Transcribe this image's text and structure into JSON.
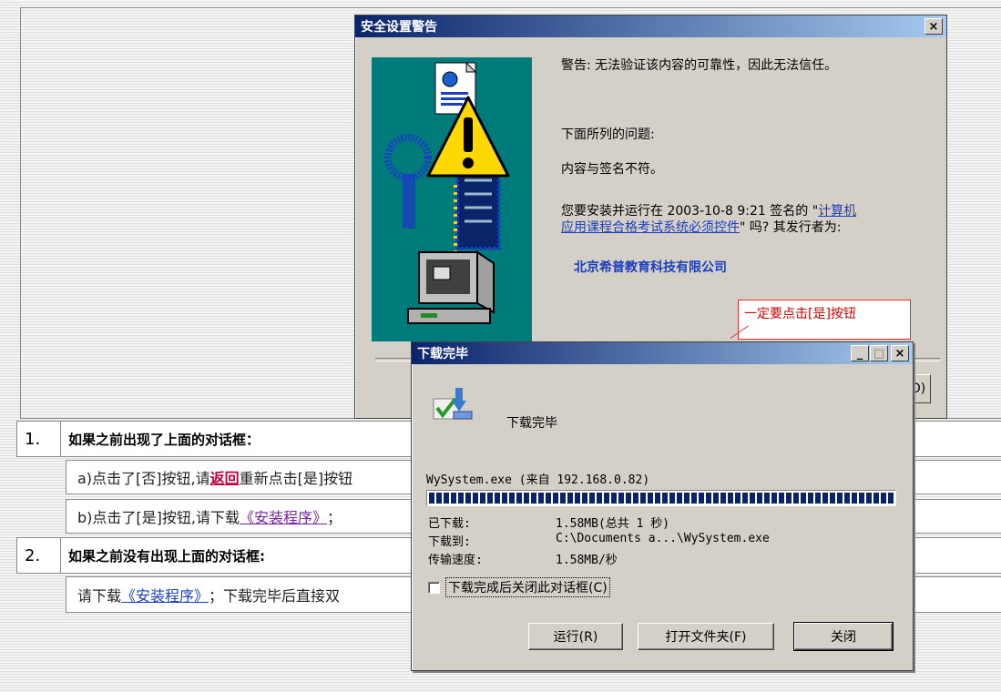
{
  "security_dialog": {
    "title": "安全设置警告",
    "close_label": "×",
    "warning": "警告: 无法验证该内容的可靠性，因此无法信任。",
    "problems_heading": "下面所列的问题:",
    "problem_item": "内容与签名不符。",
    "question_prefix": "您要安装并运行在 2003-10-8 9:21 签名的 \"",
    "control_name_line1": "计算机",
    "control_name_line2": "应用课程合格考试系统必须控件",
    "question_suffix": "\" 吗? 其发行者为:",
    "publisher": "北京希普教育科技有限公司",
    "partial_button": "O)",
    "callout": "一定要点击[是]按钮"
  },
  "instructions": {
    "section1": {
      "number": "1.",
      "title": "如果之前出现了上面的对话框：",
      "a_prefix": "a)点击了[否]按钮,请",
      "a_link": "返回",
      "a_suffix": "重新点击[是]按钮",
      "b_prefix": "b)点击了[是]按钮,请下载",
      "b_link": "《安装程序》",
      "b_suffix": "；"
    },
    "section2": {
      "number": "2.",
      "title": "如果之前没有出现上面的对话框:",
      "text_prefix": "请下载",
      "link": "《安装程序》",
      "text_suffix": "；下载完毕后直接双"
    }
  },
  "download_dialog": {
    "title": "下载完毕",
    "minimize_label": "_",
    "maximize_label": "□",
    "close_label": "×",
    "header": "下载完毕",
    "file_line": "WySystem.exe (来自 192.168.0.82)",
    "progress": 1.0,
    "downloaded_label": "已下载:",
    "downloaded_value": "1.58MB(总共 1 秒)",
    "saved_to_label": "下载到:",
    "saved_to_value": "C:\\Documents a...\\WySystem.exe",
    "speed_label": "传输速度:",
    "speed_value": "1.58MB/秒",
    "close_on_complete_label": "下载完成后关闭此对话框(C)",
    "close_on_complete_checked": false,
    "run_button": "运行(R)",
    "open_folder_button": "打开文件夹(F)",
    "close_button": "关闭"
  }
}
